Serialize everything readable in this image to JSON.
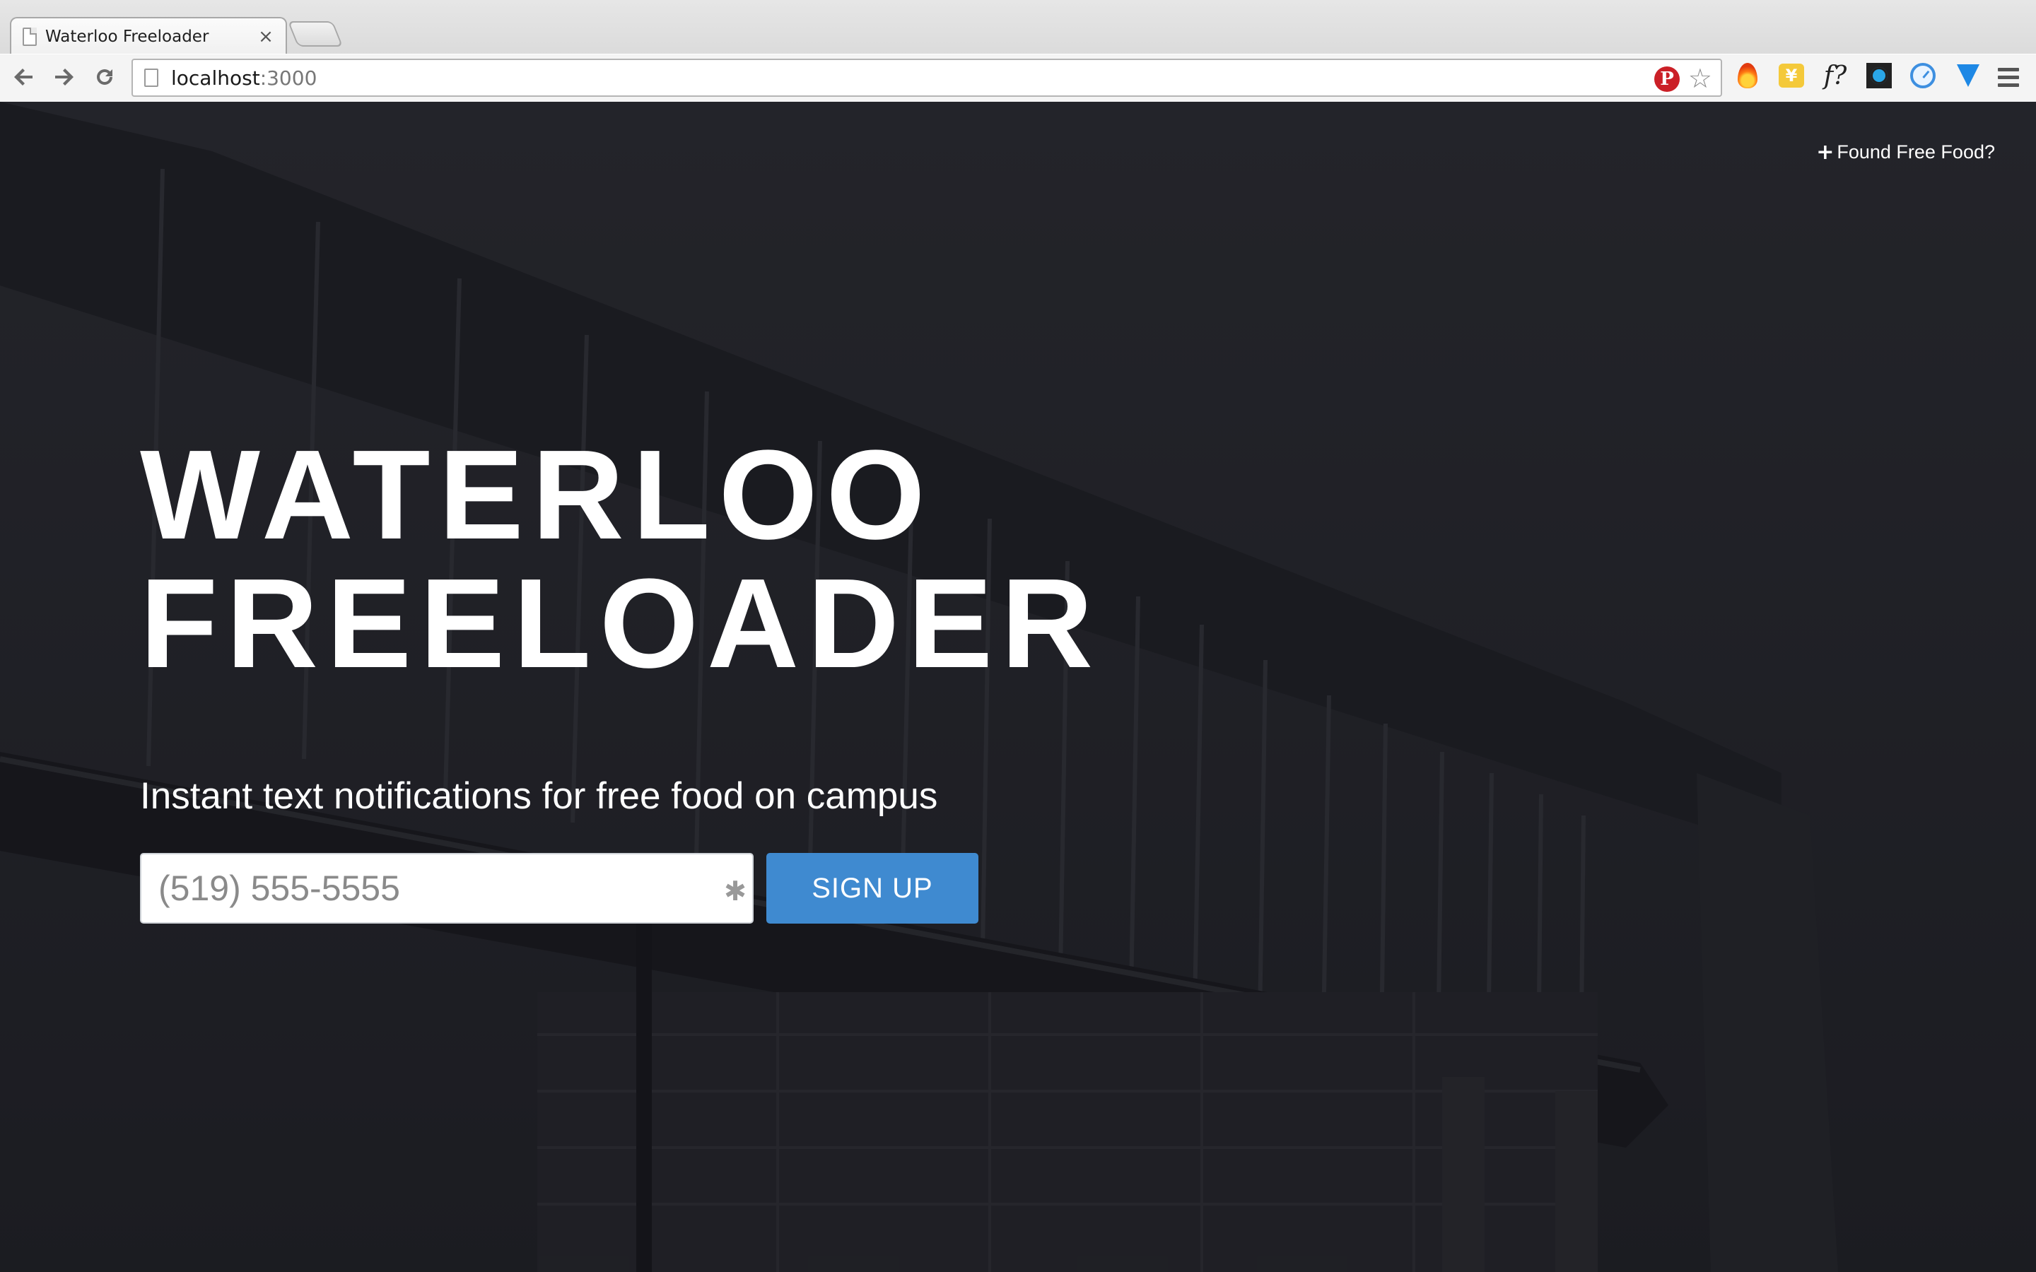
{
  "browser": {
    "tab": {
      "title": "Waterloo Freeloader",
      "close_glyph": "×"
    },
    "address_bar": {
      "host": "localhost",
      "port": ":3000"
    },
    "icons": {
      "back": "back-arrow-icon",
      "forward": "forward-arrow-icon",
      "reload": "reload-icon",
      "bookmark": "star-icon",
      "pinterest": "pinterest-icon",
      "menu": "hamburger-menu-icon"
    },
    "extensions": [
      "fire-extension-icon",
      "yen-extension-icon",
      "font-identifier-extension-icon",
      "bug-extension-icon",
      "clock-extension-icon",
      "gem-extension-icon"
    ],
    "extension_glyphs": {
      "yen": "¥",
      "font": "f?",
      "pinterest": "P",
      "star": "☆"
    }
  },
  "page": {
    "header_link": {
      "plus": "+",
      "label": "Found Free Food?"
    },
    "hero": {
      "title_line1": "WATERLOO",
      "title_line2": "FREELOADER",
      "tagline": "Instant text notifications for free food on campus"
    },
    "form": {
      "phone_placeholder": "(519) 555-5555",
      "required_mark": "✱",
      "submit_label": "SIGN UP"
    },
    "colors": {
      "button": "#3f8ad0",
      "background": "#1c1d22",
      "text": "#ffffff"
    }
  }
}
